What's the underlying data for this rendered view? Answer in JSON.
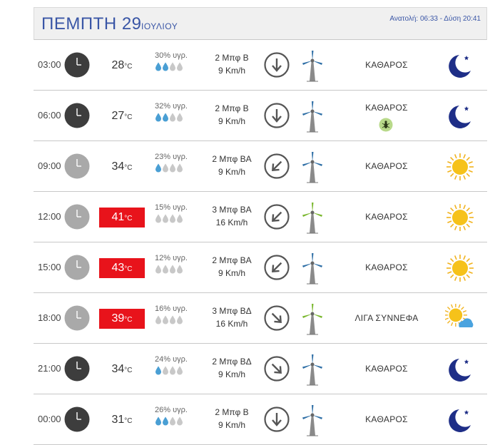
{
  "header": {
    "day": "ΠΕΜΠΤΗ 29",
    "month": "ΙΟΥΛΙΟΥ",
    "sun_times": "Ανατολή: 06:33  - Δύση 20:41"
  },
  "colors": {
    "accent": "#3a56a6",
    "hot": "#e8131b",
    "drop_on": "#4a9fd4",
    "drop_off": "#c8c8c8"
  },
  "rows": [
    {
      "time": "03:00",
      "clock": "night",
      "temp": "28",
      "unit": "°C",
      "hot": false,
      "humidity": "30% υγρ.",
      "drops_filled": 2,
      "wind_force": "2 Μπφ Β",
      "wind_speed": "9 Km/h",
      "wind_dir": "arrow-down-icon",
      "turbine": "grey",
      "condition": "ΚΑΘΑΡΟΣ",
      "mosquito": false,
      "icon": "moon-icon"
    },
    {
      "time": "06:00",
      "clock": "night",
      "temp": "27",
      "unit": "°C",
      "hot": false,
      "humidity": "32% υγρ.",
      "drops_filled": 2,
      "wind_force": "2 Μπφ Β",
      "wind_speed": "9 Km/h",
      "wind_dir": "arrow-down-icon",
      "turbine": "grey",
      "condition": "ΚΑΘΑΡΟΣ",
      "mosquito": true,
      "icon": "moon-icon"
    },
    {
      "time": "09:00",
      "clock": "day",
      "temp": "34",
      "unit": "°C",
      "hot": false,
      "humidity": "23% υγρ.",
      "drops_filled": 1,
      "wind_force": "2 Μπφ ΒΑ",
      "wind_speed": "9 Km/h",
      "wind_dir": "arrow-down-left-icon",
      "turbine": "grey",
      "condition": "ΚΑΘΑΡΟΣ",
      "mosquito": false,
      "icon": "sun-icon"
    },
    {
      "time": "12:00",
      "clock": "day",
      "temp": "41",
      "unit": "°C",
      "hot": true,
      "humidity": "15% υγρ.",
      "drops_filled": 0,
      "wind_force": "3 Μπφ ΒΑ",
      "wind_speed": "16 Km/h",
      "wind_dir": "arrow-down-left-icon",
      "turbine": "green",
      "condition": "ΚΑΘΑΡΟΣ",
      "mosquito": false,
      "icon": "sun-icon"
    },
    {
      "time": "15:00",
      "clock": "day",
      "temp": "43",
      "unit": "°C",
      "hot": true,
      "humidity": "12% υγρ.",
      "drops_filled": 0,
      "wind_force": "2 Μπφ ΒΑ",
      "wind_speed": "9 Km/h",
      "wind_dir": "arrow-down-left-icon",
      "turbine": "grey",
      "condition": "ΚΑΘΑΡΟΣ",
      "mosquito": false,
      "icon": "sun-icon"
    },
    {
      "time": "18:00",
      "clock": "day",
      "temp": "39",
      "unit": "°C",
      "hot": true,
      "humidity": "16% υγρ.",
      "drops_filled": 0,
      "wind_force": "3 Μπφ ΒΔ",
      "wind_speed": "16 Km/h",
      "wind_dir": "arrow-down-right-icon",
      "turbine": "green",
      "condition": "ΛΙΓΑ ΣΥΝΝΕΦΑ",
      "mosquito": false,
      "icon": "sun-cloud-icon"
    },
    {
      "time": "21:00",
      "clock": "night",
      "temp": "34",
      "unit": "°C",
      "hot": false,
      "humidity": "24% υγρ.",
      "drops_filled": 1,
      "wind_force": "2 Μπφ ΒΔ",
      "wind_speed": "9 Km/h",
      "wind_dir": "arrow-down-right-icon",
      "turbine": "grey",
      "condition": "ΚΑΘΑΡΟΣ",
      "mosquito": false,
      "icon": "moon-icon"
    },
    {
      "time": "00:00",
      "clock": "night",
      "temp": "31",
      "unit": "°C",
      "hot": false,
      "humidity": "26% υγρ.",
      "drops_filled": 2,
      "wind_force": "2 Μπφ Β",
      "wind_speed": "9 Km/h",
      "wind_dir": "arrow-down-icon",
      "turbine": "grey",
      "condition": "ΚΑΘΑΡΟΣ",
      "mosquito": false,
      "icon": "moon-icon"
    }
  ]
}
